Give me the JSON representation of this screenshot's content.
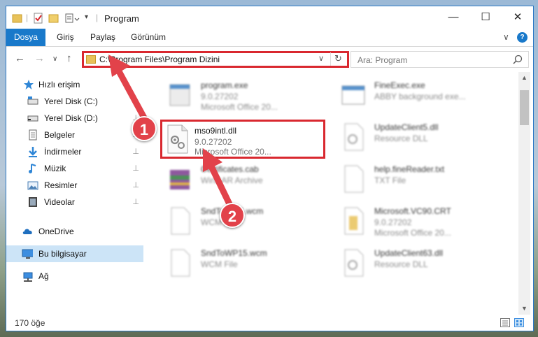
{
  "window": {
    "title": "Program",
    "minimize": "—",
    "maximize": "☐",
    "close": "✕"
  },
  "ribbon": {
    "tabs": [
      "Dosya",
      "Giriş",
      "Paylaş",
      "Görünüm"
    ],
    "expand": "∨",
    "help": "?"
  },
  "nav": {
    "back": "←",
    "forward": "→",
    "recent": "∨",
    "up": "↑",
    "address": "C:\\Program Files\\Program Dizini",
    "address_chevron": "∨",
    "refresh": "↻",
    "search_placeholder": "Ara: Program"
  },
  "sidebar": {
    "items": [
      {
        "label": "Hızlı erişim",
        "icon": "star-icon",
        "pinned": false
      },
      {
        "label": "Yerel Disk (C:)",
        "icon": "drive-icon",
        "pinned": true
      },
      {
        "label": "Yerel Disk (D:)",
        "icon": "drive-icon",
        "pinned": true
      },
      {
        "label": "Belgeler",
        "icon": "documents-icon",
        "pinned": true
      },
      {
        "label": "İndirmeler",
        "icon": "download-icon",
        "pinned": true
      },
      {
        "label": "Müzik",
        "icon": "music-icon",
        "pinned": true
      },
      {
        "label": "Resimler",
        "icon": "pictures-icon",
        "pinned": true
      },
      {
        "label": "Videolar",
        "icon": "video-icon",
        "pinned": true
      },
      {
        "label": "OneDrive",
        "icon": "cloud-icon",
        "pinned": false
      },
      {
        "label": "Bu bilgisayar",
        "icon": "computer-icon",
        "pinned": false
      },
      {
        "label": "Ağ",
        "icon": "network-icon",
        "pinned": false
      }
    ],
    "pin_glyph": "📌"
  },
  "files": {
    "left": [
      {
        "name": "program.exe",
        "line2": "9.0.27202",
        "line3": "Microsoft Office 20..."
      },
      {
        "name": "mso9intl.dll",
        "line2": "9.0.27202",
        "line3": "Microsoft Office 20..."
      },
      {
        "name": "Certificates.cab",
        "line2": "WinRAR Archive",
        "line3": ""
      },
      {
        "name": "SndToWPS.wcm",
        "line2": "WCM File",
        "line3": ""
      },
      {
        "name": "SndToWP15.wcm",
        "line2": "WCM File",
        "line3": ""
      }
    ],
    "right": [
      {
        "name": "FineExec.exe",
        "line2": "ABBY background exe...",
        "line3": ""
      },
      {
        "name": "UpdateClient5.dll",
        "line2": "Resource DLL",
        "line3": ""
      },
      {
        "name": "help.fineReader.txt",
        "line2": "TXT File",
        "line3": ""
      },
      {
        "name": "Microsoft.VC90.CRT",
        "line2": "9.0.27202",
        "line3": "Microsoft Office 20..."
      },
      {
        "name": "UpdateClient63.dll",
        "line2": "Resource DLL",
        "line3": ""
      }
    ]
  },
  "status": {
    "count": "170 öğe"
  },
  "annotations": {
    "marker1": "1",
    "marker2": "2",
    "color": "#e2424a"
  },
  "colors": {
    "accent": "#1979ca",
    "highlight_box": "#d9282f",
    "selection": "#cce4f7"
  }
}
